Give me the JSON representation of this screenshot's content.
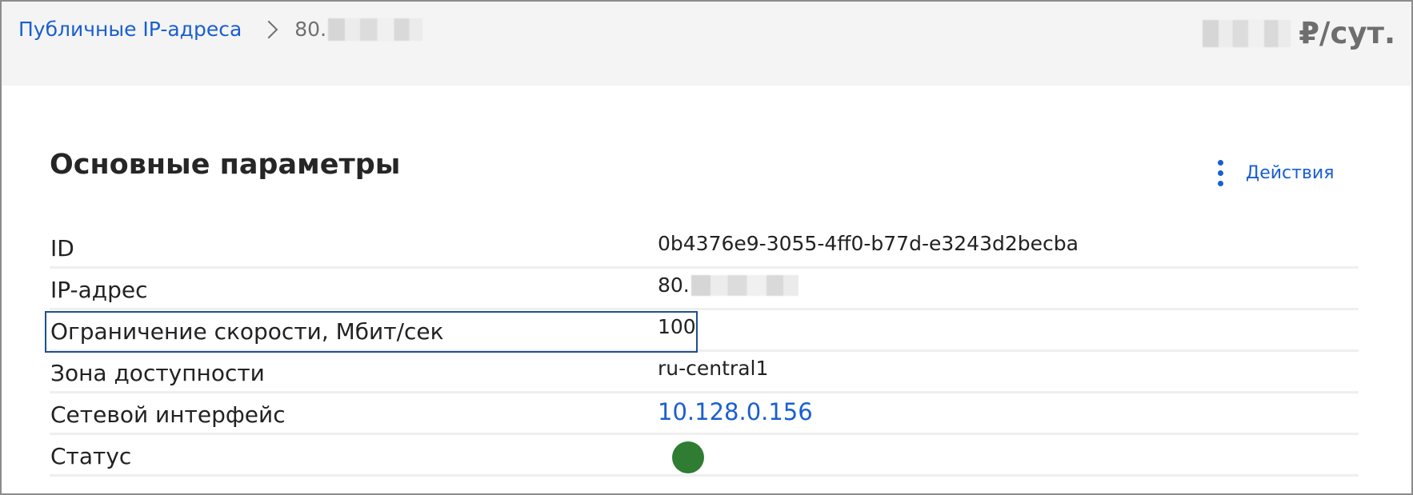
{
  "breadcrumb": {
    "parent": "Публичные IP-адреса",
    "current_prefix": "80."
  },
  "header": {
    "price_suffix": "₽/сут."
  },
  "section": {
    "title": "Основные параметры",
    "actions_label": "Действия"
  },
  "params": {
    "id": {
      "label": "ID",
      "value": "0b4376e9-3055-4ff0-b77d-e3243d2becba"
    },
    "ip": {
      "label": "IP-адрес",
      "value_prefix": "80."
    },
    "speed": {
      "label": "Ограничение скорости, Мбит/сек",
      "value": "100"
    },
    "zone": {
      "label": "Зона доступности",
      "value": "ru-central1"
    },
    "iface": {
      "label": "Сетевой интерфейс",
      "value": "10.128.0.156"
    },
    "status": {
      "label": "Статус",
      "indicator_color": "#2e7d32"
    }
  },
  "colors": {
    "link": "#1a5fd0",
    "highlight_border": "#1e4f8f"
  },
  "icons": {
    "actions": "vertical-dots-icon",
    "breadcrumb_separator": "chevron-right-icon"
  }
}
